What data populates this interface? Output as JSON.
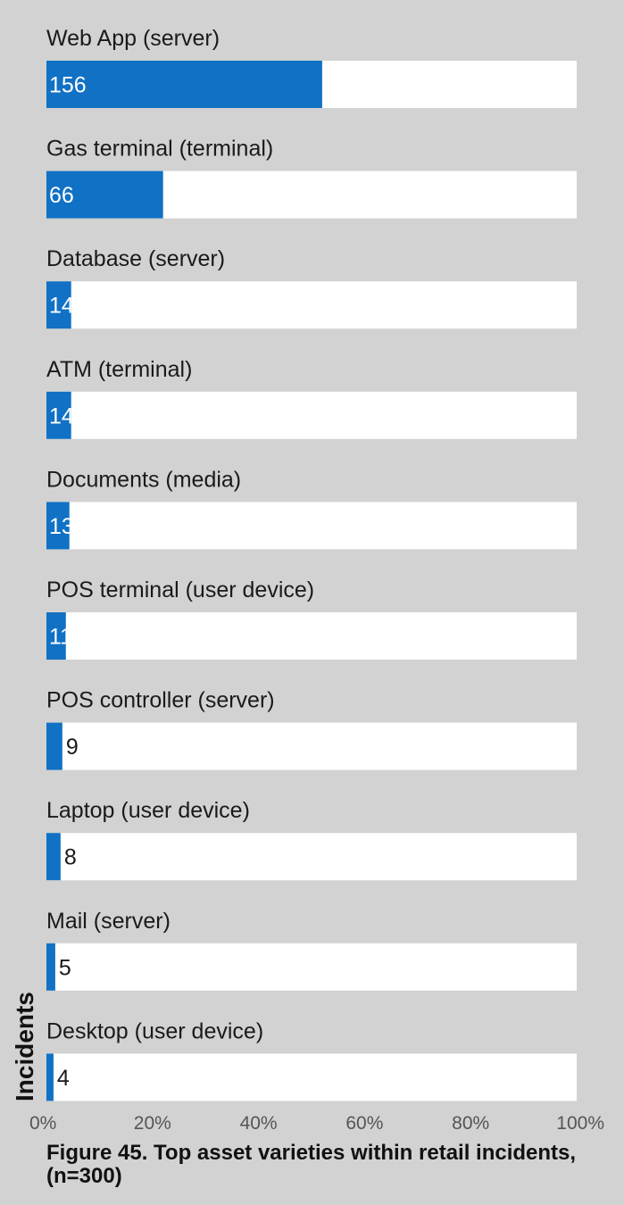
{
  "chart_data": {
    "type": "bar",
    "orientation": "horizontal",
    "categories": [
      "Web App (server)",
      "Gas terminal (terminal)",
      "Database (server)",
      "ATM (terminal)",
      "Documents (media)",
      "POS terminal (user device)",
      "POS controller (server)",
      "Laptop (user device)",
      "Mail (server)",
      "Desktop (user device)"
    ],
    "values": [
      156,
      66,
      14,
      14,
      13,
      11,
      9,
      8,
      5,
      4
    ],
    "value_labels": [
      "156",
      "66",
      "14",
      "14",
      "13",
      "11",
      "9",
      "8",
      "5",
      "4"
    ],
    "n": 300,
    "xlim": [
      0,
      100
    ],
    "x_tick_labels": [
      "0%",
      "20%",
      "40%",
      "60%",
      "80%",
      "100%"
    ],
    "ylabel": "Incidents",
    "caption": "Figure 45.  Top asset varieties within retail incidents, (n=300)",
    "colors": {
      "bar": "#1071c5",
      "track": "#ffffff",
      "background": "#d1d2d1",
      "label_inside": "#ffffff",
      "label_outside": "#1a1a1a"
    },
    "grid": false,
    "legend": "none"
  }
}
